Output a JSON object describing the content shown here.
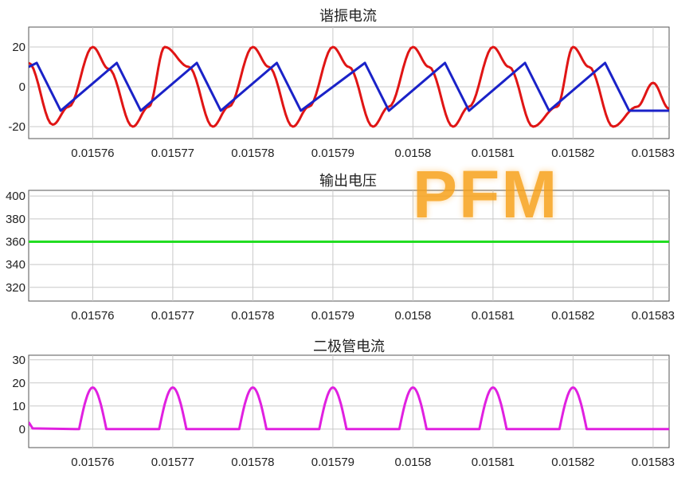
{
  "watermark": "PFM",
  "chart_data": [
    {
      "type": "line",
      "title": "谐振电流",
      "xlim": [
        0.015752,
        0.015832
      ],
      "ylim": [
        -26,
        30
      ],
      "yticks": [
        -20,
        0,
        20
      ],
      "ytick_labels": [
        "-20",
        "0",
        "20"
      ],
      "xticks": [
        0.01576,
        0.01577,
        0.01578,
        0.01579,
        0.0158,
        0.01581,
        0.01582,
        0.01583
      ],
      "xtick_labels": [
        "0.01576",
        "0.01577",
        "0.01578",
        "0.01579",
        "0.0158",
        "0.01581",
        "0.01582",
        "0.01583"
      ],
      "grid": true,
      "series": [
        {
          "color": "#e01515",
          "x": [
            0.015752,
            0.015755,
            0.015757,
            0.01576,
            0.015762,
            0.015765,
            0.015767,
            0.015769,
            0.015772,
            0.015775,
            0.015777,
            0.01578,
            0.015782,
            0.015785,
            0.015787,
            0.01579,
            0.015792,
            0.015795,
            0.015797,
            0.0158,
            0.015802,
            0.015805,
            0.015807,
            0.01581,
            0.015812,
            0.015815,
            0.015818,
            0.01582,
            0.015822,
            0.015825,
            0.015828,
            0.01583,
            0.015832
          ],
          "values": [
            12,
            -19,
            -10,
            20,
            9,
            -20,
            -10,
            20,
            10,
            -20,
            -10,
            20,
            10,
            -20,
            -10,
            20,
            10,
            -20,
            -10,
            20,
            10,
            -20,
            -10,
            20,
            10,
            -20,
            -10,
            20,
            10,
            -20,
            -10,
            2,
            -11
          ]
        },
        {
          "color": "#1a22c8",
          "x": [
            0.015752,
            0.015753,
            0.015756,
            0.015763,
            0.015766,
            0.015773,
            0.015776,
            0.015783,
            0.015786,
            0.015794,
            0.015797,
            0.015804,
            0.015807,
            0.015814,
            0.015817,
            0.015824,
            0.015827,
            0.015832
          ],
          "values": [
            10,
            12,
            -12,
            12,
            -12,
            12,
            -12,
            12,
            -12,
            12,
            -12,
            12,
            -12,
            12,
            -12,
            12,
            -12,
            -12
          ]
        }
      ]
    },
    {
      "type": "line",
      "title": "输出电压",
      "xlim": [
        0.015752,
        0.015832
      ],
      "ylim": [
        308,
        405
      ],
      "yticks": [
        320,
        340,
        360,
        380,
        400
      ],
      "ytick_labels": [
        "320",
        "340",
        "360",
        "380",
        "400"
      ],
      "xticks": [
        0.01576,
        0.01577,
        0.01578,
        0.01579,
        0.0158,
        0.01581,
        0.01582,
        0.01583
      ],
      "xtick_labels": [
        "0.01576",
        "0.01577",
        "0.01578",
        "0.01579",
        "0.0158",
        "0.01581",
        "0.01582",
        "0.01583"
      ],
      "grid": true,
      "series": [
        {
          "color": "#22dd22",
          "x": [
            0.015752,
            0.015832
          ],
          "values": [
            360,
            360
          ]
        }
      ]
    },
    {
      "type": "line",
      "title": "二极管电流",
      "xlim": [
        0.015752,
        0.015832
      ],
      "ylim": [
        -8,
        32
      ],
      "yticks": [
        0,
        10,
        20,
        30
      ],
      "ytick_labels": [
        "0",
        "10",
        "20",
        "30"
      ],
      "xticks": [
        0.01576,
        0.01577,
        0.01578,
        0.01579,
        0.0158,
        0.01581,
        0.01582,
        0.01583
      ],
      "xtick_labels": [
        "0.01576",
        "0.01577",
        "0.01578",
        "0.01579",
        "0.0158",
        "0.01581",
        "0.01582",
        "0.01583"
      ],
      "grid": true,
      "series": [
        {
          "color": "#e020e0",
          "pulse_peaks": [
            0.01576,
            0.01577,
            0.01578,
            0.01579,
            0.0158,
            0.01581,
            0.01582
          ],
          "pulse_peak_value": 18,
          "pulse_half_width": 1.7e-06,
          "baseline": 0
        }
      ]
    }
  ]
}
